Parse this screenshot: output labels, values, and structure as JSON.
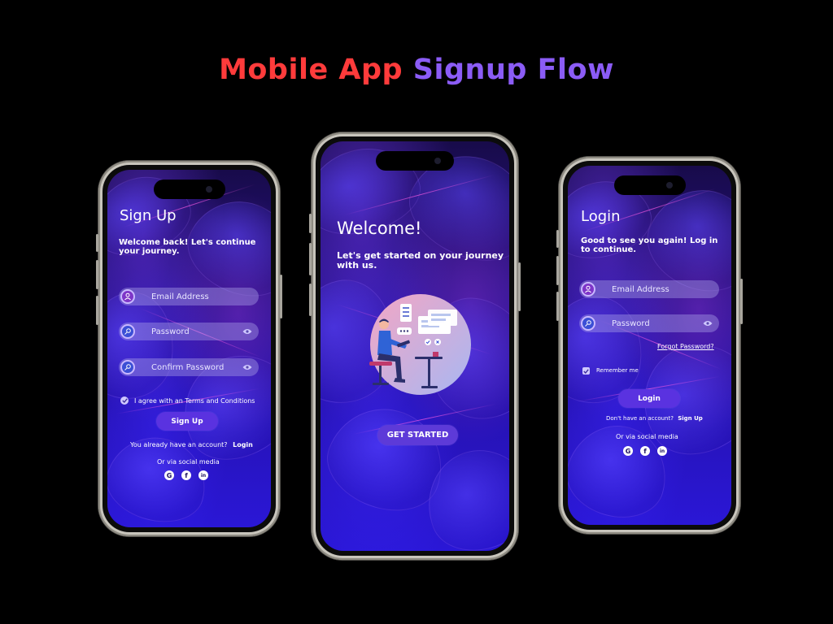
{
  "headline": {
    "part1": "Mobile App",
    "part2": "Signup Flow"
  },
  "signup": {
    "title": "Sign Up",
    "subtitle_line1": "Welcome back! Let's continue",
    "subtitle_line2": "your journey.",
    "email_placeholder": "Email Address",
    "password_placeholder": "Password",
    "confirm_placeholder": "Confirm Password",
    "terms": "I agree with an Terms and Conditions",
    "button": "Sign Up",
    "have_account": "You already have an account?",
    "login_link": "Login",
    "social_text": "Or via social media"
  },
  "welcome": {
    "title": "Welcome!",
    "subtitle_line1": "Let's get started on your journey",
    "subtitle_line2": "with us.",
    "button": "GET STARTED"
  },
  "login": {
    "title": "Login",
    "subtitle_line1": "Good to see you again! Log in",
    "subtitle_line2": "to continue.",
    "email_placeholder": "Email Address",
    "password_placeholder": "Password",
    "forgot": "Forgot Password?",
    "remember": "Remember me",
    "button": "Login",
    "no_account": "Don't have an account?",
    "signup_link": "Sign Up",
    "social_text": "Or via social media"
  },
  "social_icons": {
    "google": "G",
    "facebook": "f",
    "linkedin": "in"
  },
  "colors": {
    "red": "#ff3b3b",
    "purple": "#8b5cf6",
    "button": "#5a32e0"
  }
}
